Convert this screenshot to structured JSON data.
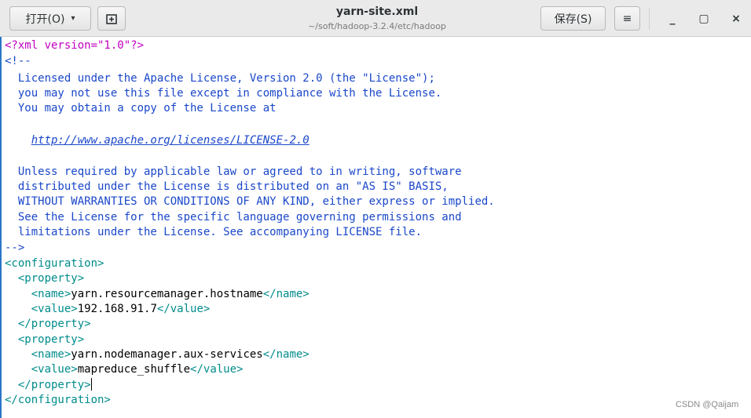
{
  "header": {
    "open_label": "打开(O)",
    "caret": "▾",
    "title": "yarn-site.xml",
    "subtitle": "~/soft/hadoop-3.2.4/etc/hadoop",
    "save_label": "保存(S)",
    "menu_icon": "≡",
    "minimize": "_",
    "maximize": "▢",
    "close": "×"
  },
  "editor": {
    "pi": "<?xml version=\"1.0\"?>",
    "comment_open": "<!--",
    "lic1": "  Licensed under the Apache License, Version 2.0 (the \"License\");",
    "lic2": "  you may not use this file except in compliance with the License.",
    "lic3": "  You may obtain a copy of the License at",
    "url_indent": "    ",
    "url": "http://www.apache.org/licenses/LICENSE-2.0",
    "lic4": "  Unless required by applicable law or agreed to in writing, software",
    "lic5": "  distributed under the License is distributed on an \"AS IS\" BASIS,",
    "lic6": "  WITHOUT WARRANTIES OR CONDITIONS OF ANY KIND, either express or implied.",
    "lic7": "  See the License for the specific language governing permissions and",
    "lic8": "  limitations under the License. See accompanying LICENSE file.",
    "comment_close": "-->",
    "config_open": "<configuration>",
    "prop_open": "  <property>",
    "name_indent": "    ",
    "name_open": "<name>",
    "name_close": "</name>",
    "value_open": "<value>",
    "value_close": "</value>",
    "prop_close": "  </property>",
    "config_close": "</configuration>",
    "prop1_name": "yarn.resourcemanager.hostname",
    "prop1_value": "192.168.91.7",
    "prop2_name": "yarn.nodemanager.aux-services",
    "prop2_value": "mapreduce_shuffle"
  },
  "watermark": "CSDN @Qaijam"
}
